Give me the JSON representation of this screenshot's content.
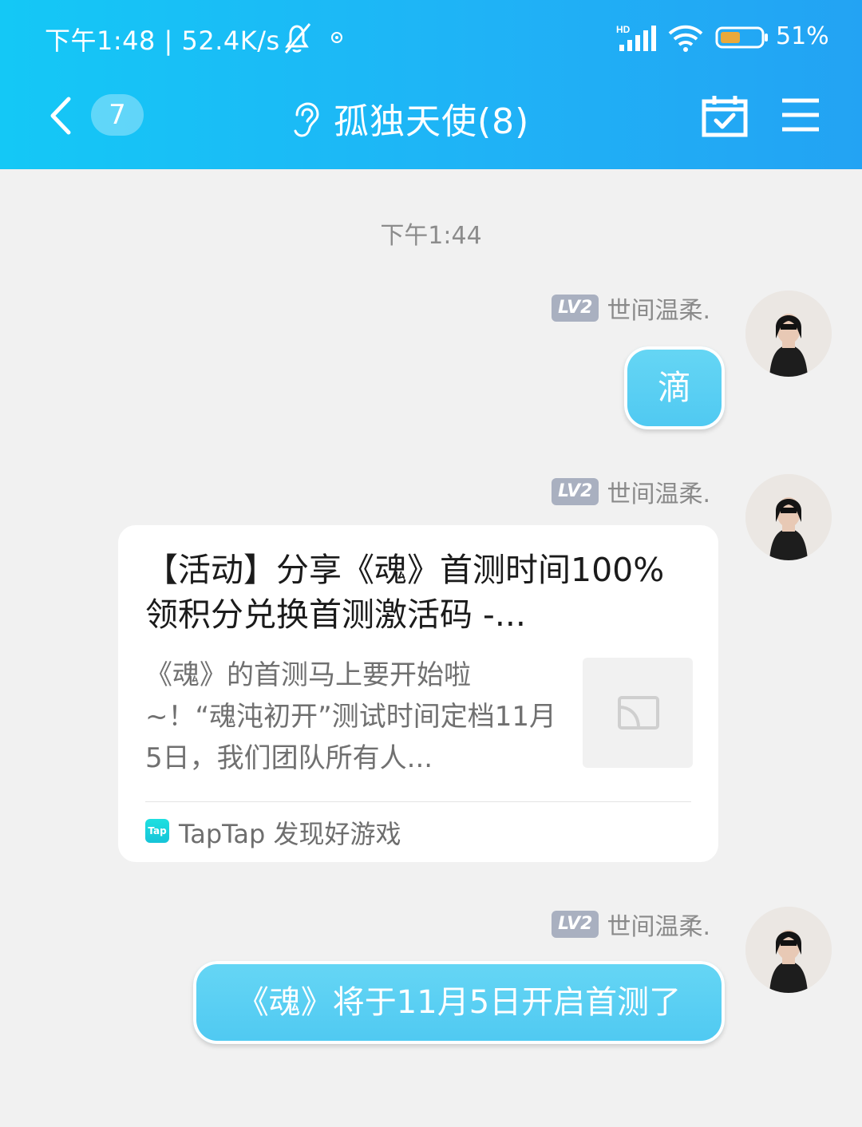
{
  "status_bar": {
    "time_and_speed": "下午1:48 | 52.4K/s",
    "network_label": "HD",
    "battery_percent": "51%",
    "battery_level": 0.51
  },
  "header": {
    "unread_count": "7",
    "title": "孤独天使(8)"
  },
  "chat": {
    "timestamp": "下午1:44",
    "messages": [
      {
        "level": "LV2",
        "sender": "世间温柔.",
        "text": "滴"
      },
      {
        "level": "LV2",
        "sender": "世间温柔.",
        "card": {
          "title": "【活动】分享《魂》首测时间100%领积分兑换首测激活码 -...",
          "description": "《魂》的首测马上要开始啦~！“魂沌初开”测试时间定档11月5日，我们团队所有人...",
          "source_logo": "Tap",
          "source": "TapTap 发现好游戏"
        }
      },
      {
        "level": "LV2",
        "sender": "世间温柔.",
        "text": "《魂》将于11月5日开启首测了"
      }
    ]
  },
  "colors": {
    "header_gradient_start": "#14c8f6",
    "header_gradient_end": "#23a3f3",
    "bubble": "#4fc9f2",
    "level_badge": "#a9b0c0",
    "battery_fill": "#e9a93a"
  }
}
